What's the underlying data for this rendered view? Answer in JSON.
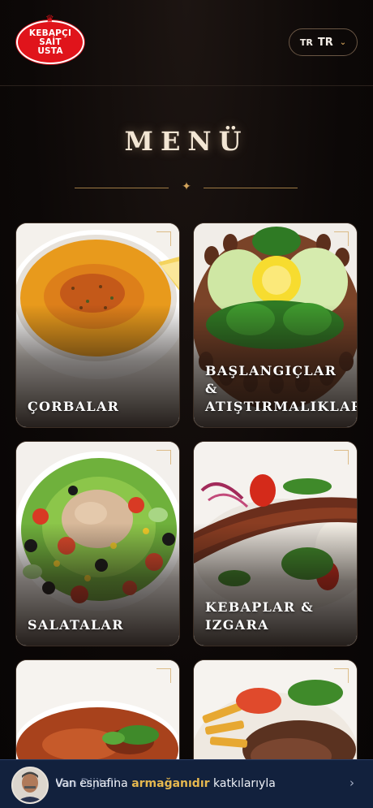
{
  "header": {
    "logo_lines": [
      "KEBAPÇI",
      "SAİT",
      "USTA"
    ],
    "lang_flag_text": "TR",
    "lang_label": "TR",
    "lang_chevron_icon": "chevron-down-icon"
  },
  "title": "MENÜ",
  "cards": [
    {
      "label": "Çorbalar",
      "image_icon": "lentil-soup-photo"
    },
    {
      "label": "Başlangıçlar & Atıştırmalıklar",
      "image_icon": "cig-kofte-photo"
    },
    {
      "label": "Salatalar",
      "image_icon": "tuna-salad-photo"
    },
    {
      "label": "Kebaplar & Izgara",
      "image_icon": "adana-kebab-photo"
    },
    {
      "label": "",
      "image_icon": "stew-photo"
    },
    {
      "label": "",
      "image_icon": "doner-plate-photo"
    }
  ],
  "banner": {
    "text_part1": "Van Dijital",
    "text_dim": "l",
    "text_part2": "Van esnafına ",
    "text_bold": "armağanıdır",
    "text_part3": " katkılarıyla",
    "chevron_icon": "chevron-right-icon"
  },
  "colors": {
    "background": "#0c0807",
    "accent_gold": "#d2a45c",
    "logo_red": "#e0141b",
    "banner_bg": "#12213d"
  }
}
